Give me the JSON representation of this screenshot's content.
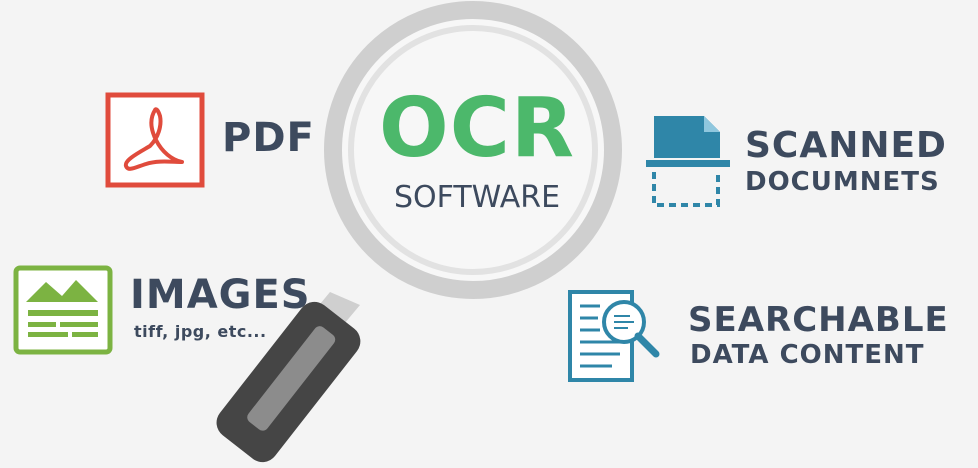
{
  "center": {
    "title": "OCR",
    "subtitle": "SOFTWARE"
  },
  "items": {
    "pdf": {
      "label": "PDF",
      "icon": "pdf-file-icon",
      "color": "#e04b3c"
    },
    "images": {
      "label": "IMAGES",
      "sublabel": "tiff, jpg, etc...",
      "icon": "image-file-icon",
      "color": "#7cb342"
    },
    "scanned": {
      "line1": "SCANNED",
      "line2": "DOCUMNETS",
      "icon": "scanner-document-icon",
      "color": "#2f86a8"
    },
    "searchable": {
      "line1": "SEARCHABLE",
      "line2": "DATA CONTENT",
      "icon": "document-search-icon",
      "color": "#2f86a8"
    }
  },
  "colors": {
    "text_dark": "#3d4a5e",
    "ocr_green": "#4cb86b",
    "glass_ring": "#cfcfcf",
    "handle_dark": "#454545"
  }
}
